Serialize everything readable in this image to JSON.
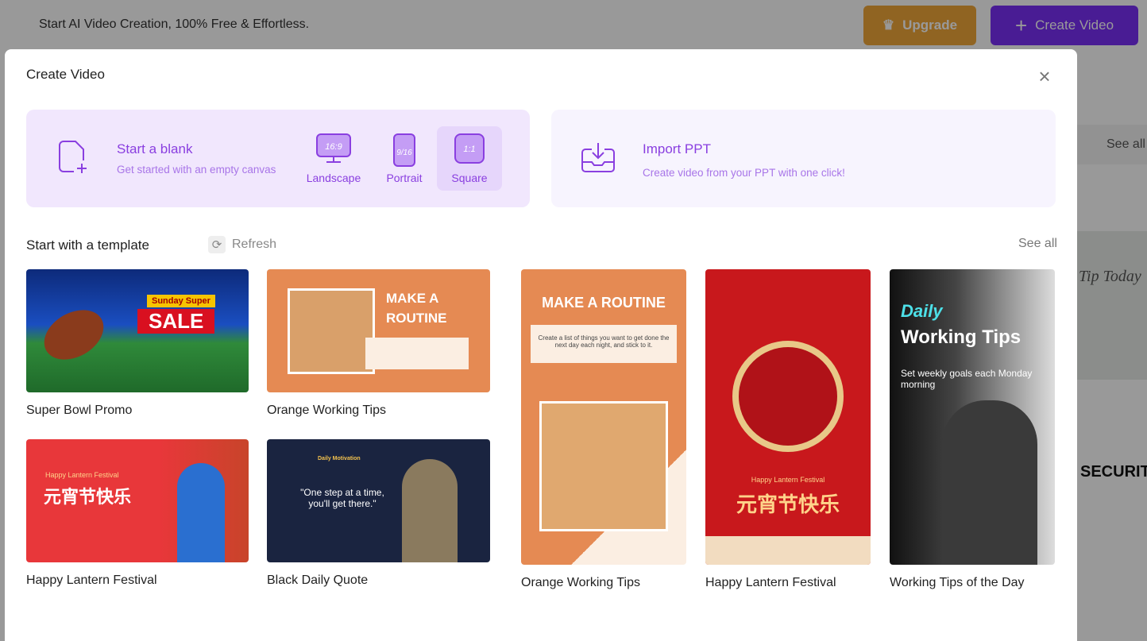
{
  "topbar": {
    "tagline": "Start AI Video Creation, 100% Free & Effortless.",
    "upgrade_label": "Upgrade",
    "create_label": "Create Video"
  },
  "background": {
    "see_all": "See all",
    "tip_today": "Tip Today",
    "security": "SECURITY"
  },
  "modal": {
    "title": "Create Video",
    "blank": {
      "title": "Start a blank",
      "subtitle": "Get started with an empty canvas",
      "ratios": [
        {
          "label": "Landscape",
          "badge": "16:9"
        },
        {
          "label": "Portrait",
          "badge": "9/16"
        },
        {
          "label": "Square",
          "badge": "1:1",
          "selected": true
        }
      ]
    },
    "ppt": {
      "title": "Import PPT",
      "subtitle": "Create video from your PPT with one click!"
    },
    "templates_heading": "Start with a template",
    "refresh_label": "Refresh",
    "see_all": "See all",
    "templates": [
      {
        "name": "Super Bowl Promo",
        "headline": "SALE",
        "sub": "Sunday Super"
      },
      {
        "name": "Orange Working Tips",
        "headline": "MAKE A ROUTINE"
      },
      {
        "name": "Happy Lantern Festival",
        "headline": "元宵节快乐",
        "sub": "Happy Lantern Festival"
      },
      {
        "name": "Black Daily Quote",
        "headline": "\"One step at a time, you'll get there.\"",
        "sub": "Daily Motivation"
      },
      {
        "name": "Orange Working Tips",
        "headline": "MAKE A ROUTINE",
        "sub": "Create a list of things you want to get done the next day each night, and stick to it."
      },
      {
        "name": "Happy Lantern Festival",
        "headline": "元宵节快乐",
        "sub": "Happy Lantern Festival"
      },
      {
        "name": "Working Tips of the Day",
        "headline": "Working Tips",
        "sub": "Set weekly goals each Monday morning",
        "script": "Daily"
      }
    ]
  },
  "colors": {
    "accent": "#7b2ff7",
    "upgrade": "#f0a73a"
  }
}
